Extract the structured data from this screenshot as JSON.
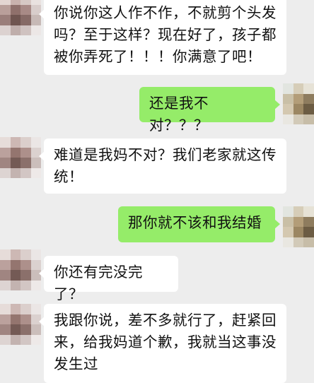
{
  "colors": {
    "background": "#ededed",
    "incoming_bubble": "#ffffff",
    "outgoing_bubble": "#95ec69",
    "text": "#111111"
  },
  "messages": [
    {
      "side": "in",
      "text": "你说你这人作不作，不就剪个头发吗？至于这样？现在好了，孩子都被你弄死了！！！你满意了吧！"
    },
    {
      "side": "out",
      "text": "还是我不对？？？"
    },
    {
      "side": "in",
      "text": "难道是我妈不对？我们老家就这传统！"
    },
    {
      "side": "out",
      "text": "那你就不该和我结婚"
    },
    {
      "side": "in",
      "text": "你还有完没完了？"
    },
    {
      "side": "in",
      "text": "我跟你说，差不多就行了，赶紧回来，给我妈道个歉，我就当这事没发生过"
    }
  ]
}
